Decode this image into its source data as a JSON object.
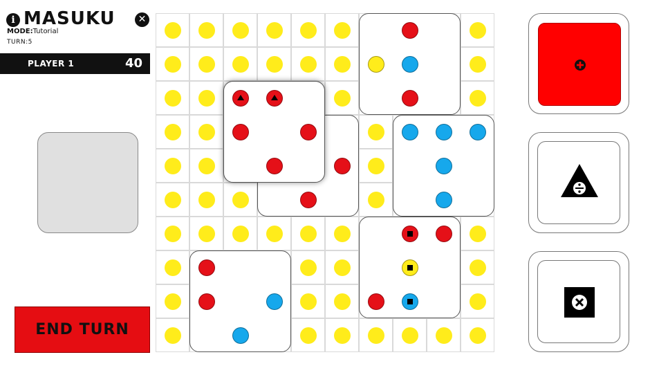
{
  "header": {
    "title": "MASUKU",
    "mode_label": "MODE:",
    "mode_value": "Tutorial",
    "turn_label": "TURN:5"
  },
  "player": {
    "name": "PLAYER 1",
    "score": "40"
  },
  "end_turn_label": "END TURN",
  "colors": {
    "yellow": "#ffec1b",
    "red": "#e51018",
    "blue": "#16a8ec",
    "board_line": "#d9d9d9",
    "end_turn": "#e50d12",
    "op_red": "#ff0000"
  },
  "board": {
    "rows": 10,
    "cols": 10,
    "cell_default_dot": "yellow"
  },
  "dice": [
    {
      "name": "die-a",
      "col": 6,
      "row": 0,
      "dots": [
        {
          "c": "red",
          "col": 7,
          "row": 0
        },
        {
          "c": "yellow",
          "col": 6,
          "row": 1
        },
        {
          "c": "blue",
          "col": 7,
          "row": 1
        },
        {
          "c": "red",
          "col": 7,
          "row": 2
        }
      ]
    },
    {
      "name": "die-b",
      "col": 3,
      "row": 3,
      "dots": [
        {
          "c": "red",
          "col": 5,
          "row": 4
        },
        {
          "c": "red",
          "col": 4,
          "row": 5
        }
      ]
    },
    {
      "name": "die-c",
      "col": 2,
      "row": 2,
      "shadow": true,
      "dots": [
        {
          "c": "red",
          "col": 2,
          "row": 2,
          "m": "triangle"
        },
        {
          "c": "red",
          "col": 3,
          "row": 2,
          "m": "triangle"
        },
        {
          "c": "red",
          "col": 2,
          "row": 3
        },
        {
          "c": "red",
          "col": 4,
          "row": 3
        },
        {
          "c": "red",
          "col": 3,
          "row": 4
        }
      ]
    },
    {
      "name": "die-d",
      "col": 7,
      "row": 3,
      "dots": [
        {
          "c": "blue",
          "col": 7,
          "row": 3
        },
        {
          "c": "blue",
          "col": 8,
          "row": 3
        },
        {
          "c": "blue",
          "col": 9,
          "row": 3
        },
        {
          "c": "blue",
          "col": 8,
          "row": 4
        },
        {
          "c": "blue",
          "col": 8,
          "row": 5
        }
      ]
    },
    {
      "name": "die-e",
      "col": 6,
      "row": 6,
      "dots": [
        {
          "c": "red",
          "col": 7,
          "row": 6,
          "m": "square"
        },
        {
          "c": "red",
          "col": 8,
          "row": 6
        },
        {
          "c": "yellow",
          "col": 7,
          "row": 7,
          "m": "square"
        },
        {
          "c": "red",
          "col": 6,
          "row": 8
        },
        {
          "c": "blue",
          "col": 7,
          "row": 8,
          "m": "square"
        }
      ]
    },
    {
      "name": "die-f",
      "col": 1,
      "row": 7,
      "dots": [
        {
          "c": "red",
          "col": 1,
          "row": 7
        },
        {
          "c": "red",
          "col": 1,
          "row": 8
        },
        {
          "c": "blue",
          "col": 3,
          "row": 8
        },
        {
          "c": "blue",
          "col": 2,
          "row": 9
        }
      ]
    }
  ],
  "operations": [
    {
      "name": "add",
      "icon": "plus-circle-icon",
      "selected": true
    },
    {
      "name": "divide",
      "icon": "divide-triangle-icon",
      "selected": false
    },
    {
      "name": "multiply",
      "icon": "multiply-square-icon",
      "selected": false
    }
  ]
}
